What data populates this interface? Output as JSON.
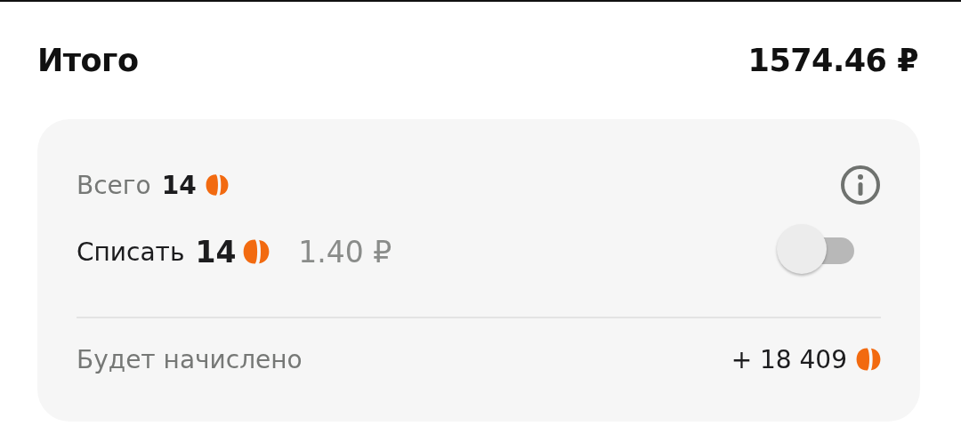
{
  "total": {
    "label": "Итого",
    "amount": "1574.46 ₽"
  },
  "bonus": {
    "total_label": "Всего",
    "total_points": "14",
    "spend_label": "Списать",
    "spend_points": "14",
    "spend_rub": "1.40 ₽",
    "spend_on": false,
    "accrue_label": "Будет начислено",
    "accrue_points": "+ 18 409"
  }
}
